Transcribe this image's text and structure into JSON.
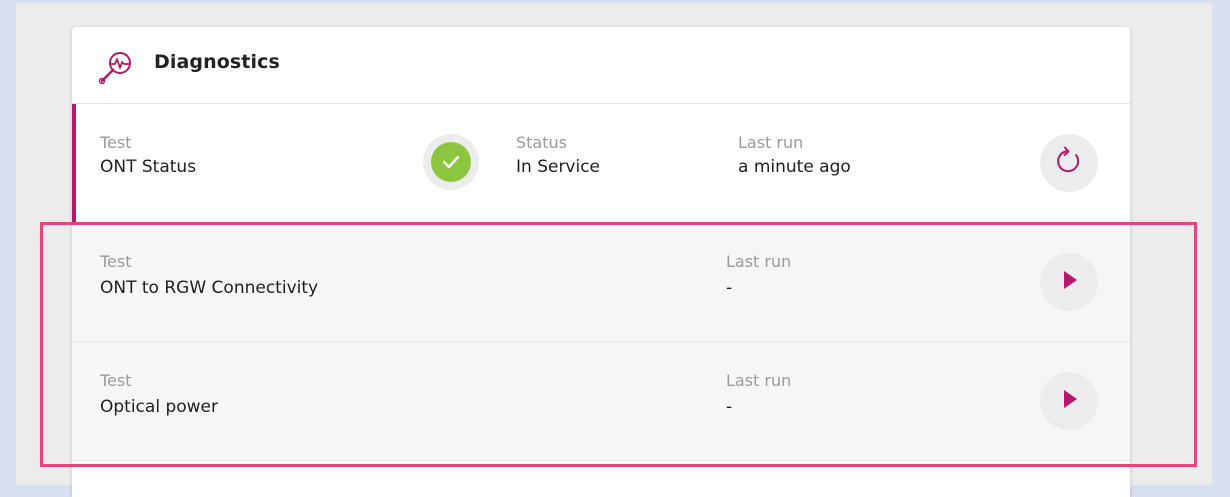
{
  "diagnostics": {
    "title": "Diagnostics",
    "icon": "diagnostics-magnifier-icon",
    "accent_color": "#b3186b",
    "highlight_color": "#e8447a",
    "rows": [
      {
        "test_label": "Test",
        "test_name": "ONT Status",
        "status_label": "Status",
        "status_value": "In Service",
        "status_icon": "check-icon",
        "status_color": "#8cc63e",
        "last_run_label": "Last run",
        "last_run_value": "a minute ago",
        "action": "refresh-icon"
      },
      {
        "test_label": "Test",
        "test_name": "ONT to RGW Connectivity",
        "last_run_label": "Last run",
        "last_run_value": "-",
        "action": "play-icon"
      },
      {
        "test_label": "Test",
        "test_name": "Optical power",
        "last_run_label": "Last run",
        "last_run_value": "-",
        "action": "play-icon"
      }
    ]
  }
}
